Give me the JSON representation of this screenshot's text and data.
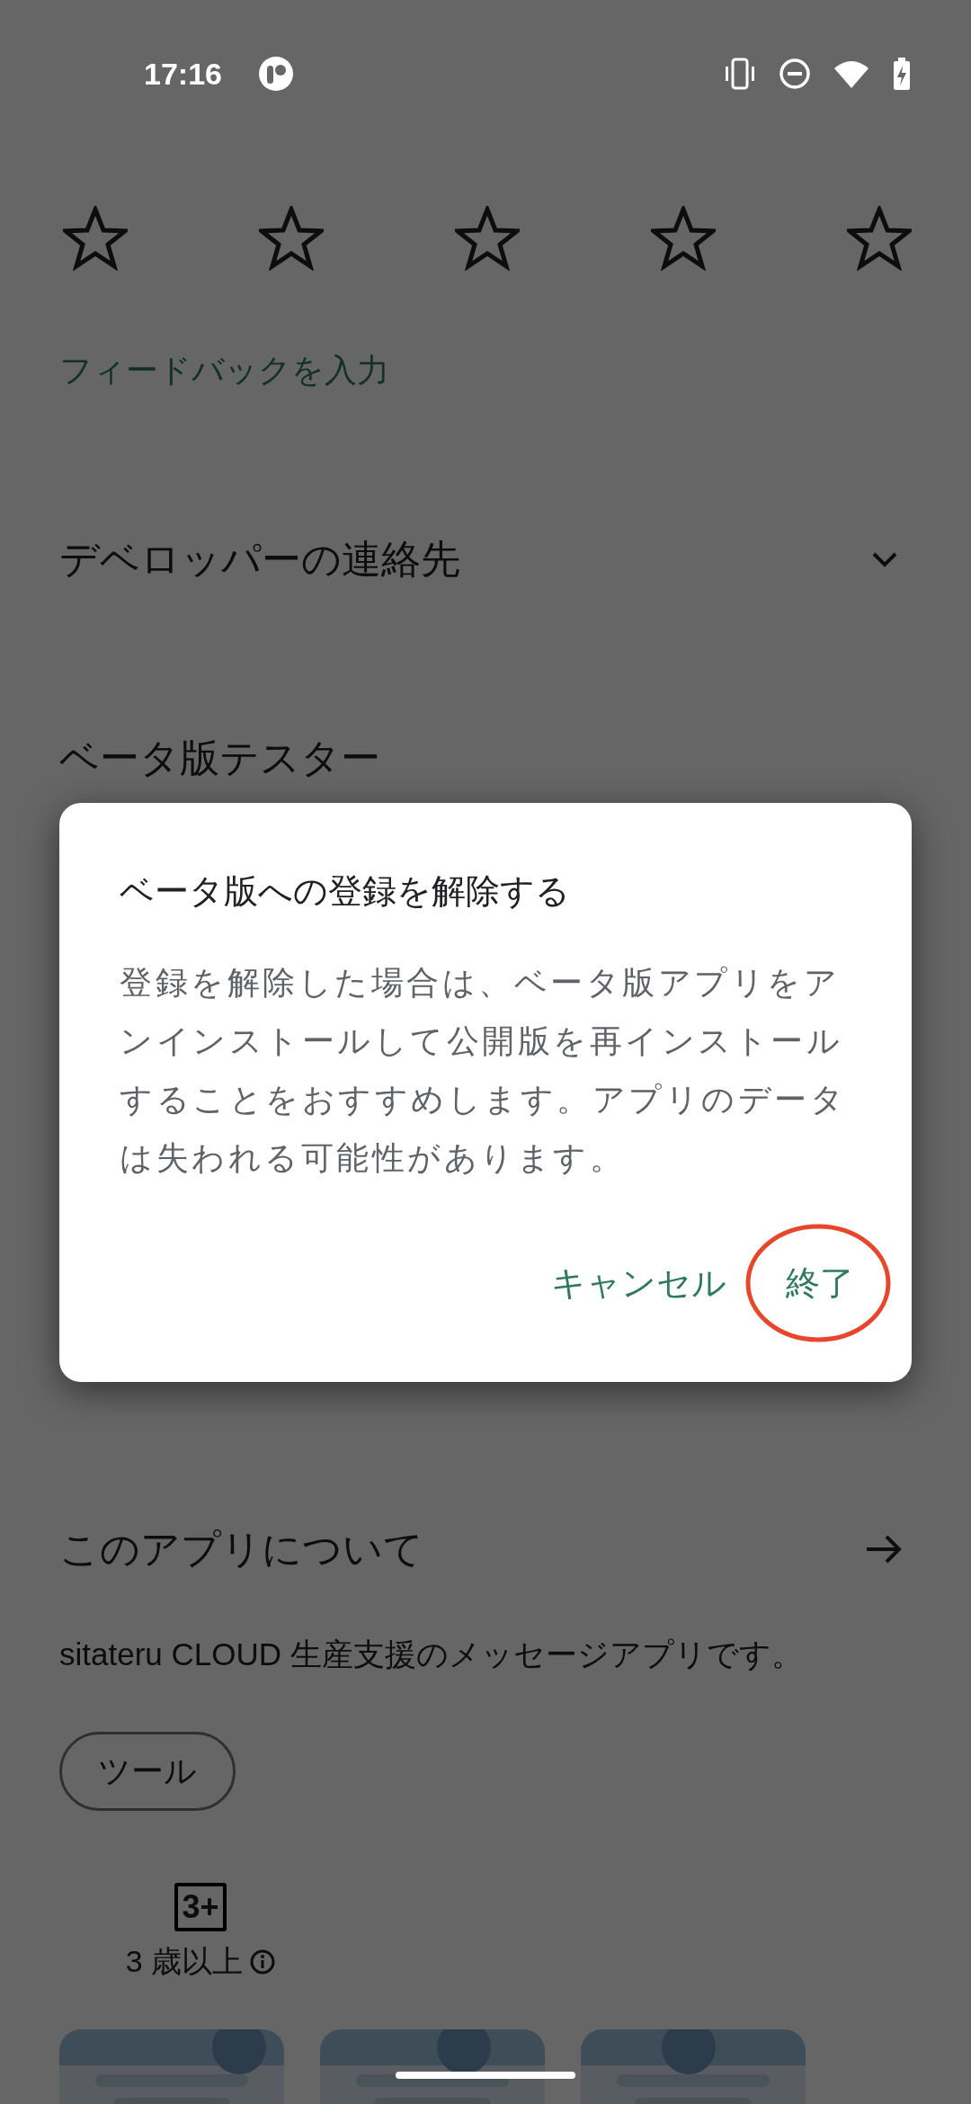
{
  "status_bar": {
    "time": "17:16"
  },
  "feedback": {
    "stars": 0,
    "link": "フィードバックを入力"
  },
  "sections": [
    {
      "title": "デベロッパーの連絡先",
      "kind": "expand",
      "expanded": false
    },
    {
      "title": "ベータ版テスター",
      "kind": "plain"
    }
  ],
  "about": {
    "title": "このアプリについて",
    "description": "sitateru CLOUD 生産支援のメッセージアプリです。",
    "tags": [
      "ツール"
    ]
  },
  "rating": {
    "badge": "3+",
    "label": "3 歳以上"
  },
  "dialog": {
    "title": "ベータ版への登録を解除する",
    "body": "登録を解除した場合は、ベータ版アプリをアンインストールして公開版を再インストールすることをおすすめします。アプリのデータは失われる可能性があります。",
    "buttons": [
      {
        "label": "キャンセル",
        "circled": false
      },
      {
        "label": "終了",
        "circled": true
      }
    ]
  }
}
